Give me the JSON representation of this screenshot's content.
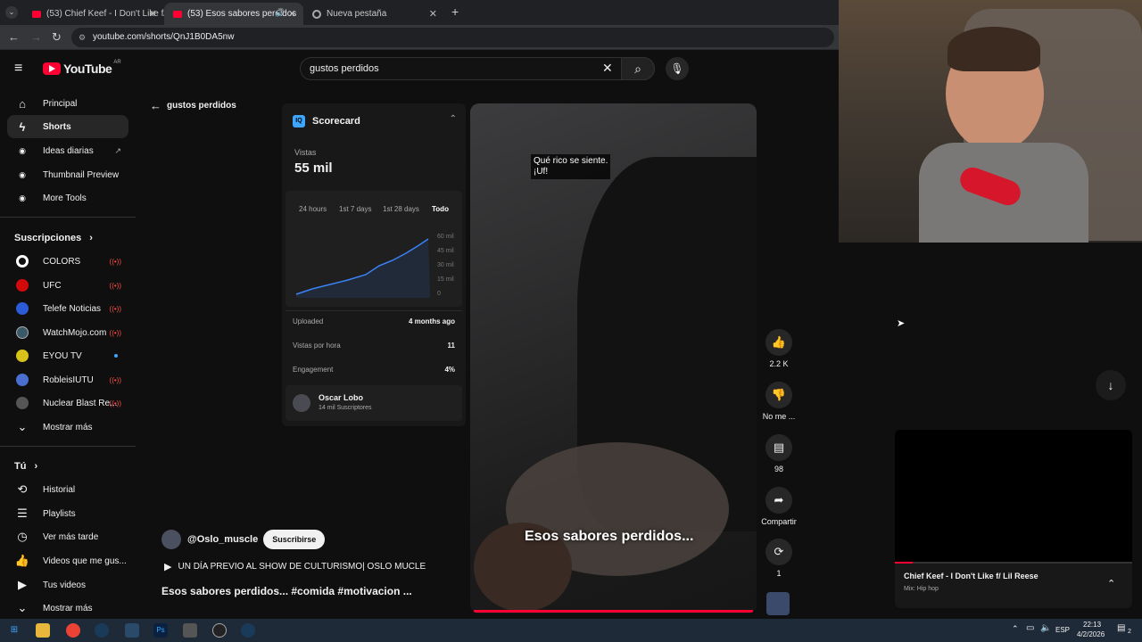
{
  "browser": {
    "tabs": [
      {
        "title": "(53) Chief Keef - I Don't Like f/ L"
      },
      {
        "title": "(53) Esos sabores perdidos"
      },
      {
        "title": "Nueva pestaña"
      }
    ],
    "url": "youtube.com/shorts/QnJ1B0DA5nw"
  },
  "youtube": {
    "logo": "YouTube",
    "region": "AR",
    "search": {
      "query": "gustos perdidos"
    },
    "back_label": "gustos perdidos",
    "sidebar": {
      "items": [
        {
          "label": "Principal",
          "icon": "home-icon"
        },
        {
          "label": "Shorts",
          "icon": "shorts-icon"
        },
        {
          "label": "Ideas diarias",
          "icon": "app-icon"
        },
        {
          "label": "Thumbnail Preview",
          "icon": "app-icon"
        },
        {
          "label": "More Tools",
          "icon": "app-icon"
        }
      ],
      "subs_title": "Suscripciones",
      "subs": [
        {
          "label": "COLORS",
          "color": "#ffffff"
        },
        {
          "label": "UFC",
          "color": "#d20a0a"
        },
        {
          "label": "Telefe Noticias",
          "color": "#2b5bd7"
        },
        {
          "label": "WatchMojo.com",
          "color": "#3a5a6a"
        },
        {
          "label": "EYOU TV",
          "color": "#d8c21a"
        },
        {
          "label": "RobleisIUTU",
          "color": "#4a6fd0"
        },
        {
          "label": "Nuclear Blast Re...",
          "color": "#555555"
        }
      ],
      "show_more": "Mostrar más",
      "you_title": "Tú",
      "you_items": [
        {
          "label": "Historial"
        },
        {
          "label": "Playlists"
        },
        {
          "label": "Ver más tarde"
        },
        {
          "label": "Videos que me gus..."
        },
        {
          "label": "Tus videos"
        }
      ],
      "show_more_2": "Mostrar más"
    },
    "scorecard": {
      "title": "Scorecard",
      "views_label": "Vistas",
      "views_value": "55 mil",
      "ranges": [
        "24 hours",
        "1st 7 days",
        "1st 28 days",
        "Todo"
      ],
      "y_ticks": [
        "60 mil",
        "45 mil",
        "30 mil",
        "15 mil",
        "0"
      ],
      "stats": [
        {
          "label": "Uploaded",
          "value": "4 months ago"
        },
        {
          "label": "Vistas por hora",
          "value": "11"
        },
        {
          "label": "Engagement",
          "value": "4%"
        }
      ],
      "channel_name": "Oscar Lobo",
      "channel_subs": "14 mil Suscriptores"
    },
    "short": {
      "subtitle_line1": "Qué rico se siente.",
      "subtitle_line2": "¡Uf!",
      "overlay_caption": "Esos sabores perdidos...",
      "channel": "@Oslo_muscle",
      "subscribe": "Suscribirse",
      "music": "UN DÍA PREVIO AL SHOW DE CULTURISMO| OSLO MUCLE",
      "title": "Esos sabores perdidos... #comida #motivacion ..."
    },
    "actions": [
      {
        "icon": "like-icon",
        "label": "2.2 K"
      },
      {
        "icon": "dislike-icon",
        "label": "No me ..."
      },
      {
        "icon": "comment-icon",
        "label": "98"
      },
      {
        "icon": "share-icon",
        "label": "Compartir"
      },
      {
        "icon": "remix-icon",
        "label": "1"
      }
    ]
  },
  "miniplayer": {
    "title": "Chief Keef - I Don't Like f/ Lil Reese",
    "subtitle": "Mix: Hip hop"
  },
  "taskbar": {
    "lang": "ESP",
    "time": "22:13",
    "date": "4/2/2026",
    "notifications": "2"
  }
}
